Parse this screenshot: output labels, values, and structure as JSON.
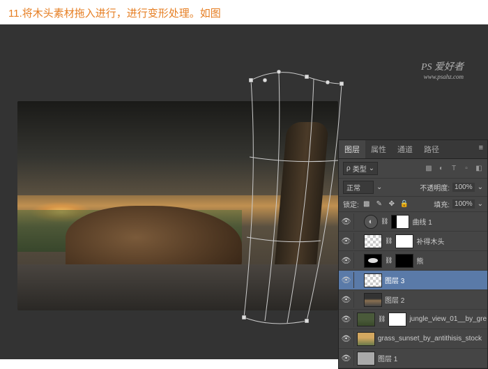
{
  "header": {
    "step_text": "11.将木头素材拖入进行，进行变形处理。如图"
  },
  "watermark": {
    "title": "PS 爱好者",
    "url": "www.psahz.com"
  },
  "panel": {
    "tabs": {
      "layers": "图层",
      "properties": "属性",
      "channels": "通道",
      "paths": "路径"
    },
    "filter_label": "类型",
    "blend_mode": "正常",
    "opacity_label": "不透明度:",
    "opacity_value": "100%",
    "lock_label": "锁定:",
    "fill_label": "填充:",
    "fill_value": "100%"
  },
  "layers": [
    {
      "name": "曲线 1",
      "type": "adjustment"
    },
    {
      "name": "补得木头",
      "type": "checker"
    },
    {
      "name": "熊",
      "type": "cloud"
    },
    {
      "name": "图层 3",
      "type": "checker",
      "selected": true
    },
    {
      "name": "图层 2",
      "type": "img1"
    },
    {
      "name": "jungle_view_01__by_gre",
      "type": "img2"
    },
    {
      "name": "grass_sunset_by_antithisis_stock",
      "type": "img3"
    },
    {
      "name": "图层 1",
      "type": "solid"
    }
  ]
}
